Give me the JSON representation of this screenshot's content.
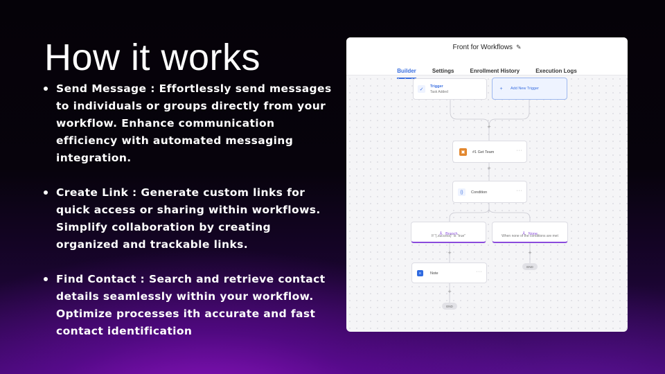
{
  "slide": {
    "title": "How it works",
    "bullets": [
      {
        "text": "Send Message : Effortlessly send messages to individuals or groups directly from your workflow. Enhance communication efficiency with automated messaging integration."
      },
      {
        "text": "Create Link : Generate custom links for quick access or sharing within workflows. Simplify collaboration by creating organized and trackable links."
      },
      {
        "text": "Find Contact : Search and retrieve contact details seamlessly within your workflow. Optimize processes ith accurate and fast contact identification"
      }
    ]
  },
  "workflow": {
    "title": "Front for Workflows",
    "tabs": [
      "Builder",
      "Settings",
      "Enrollment History",
      "Execution Logs"
    ],
    "active_tab": "Builder",
    "nodes": {
      "trigger": {
        "label": "Trigger",
        "sub": "Task Added"
      },
      "add_trigger": {
        "label": "Add New Trigger"
      },
      "get_team": {
        "label": "#1 Get Team"
      },
      "condition": {
        "label": "Condition"
      },
      "branch": {
        "label": "Branch",
        "sub": "If \"{.success}\" is \"true\""
      },
      "none": {
        "label": "None",
        "sub": "When none of the conditions are met"
      },
      "note": {
        "label": "Note"
      }
    },
    "plus_symbol": "+",
    "more_symbol": "···",
    "end_label": "END",
    "colors": {
      "accent": "#3a6fe0",
      "branch": "#8a4bdc",
      "get_team_icon": "#e2872e",
      "trigger_bg": "#eef3ff"
    }
  }
}
